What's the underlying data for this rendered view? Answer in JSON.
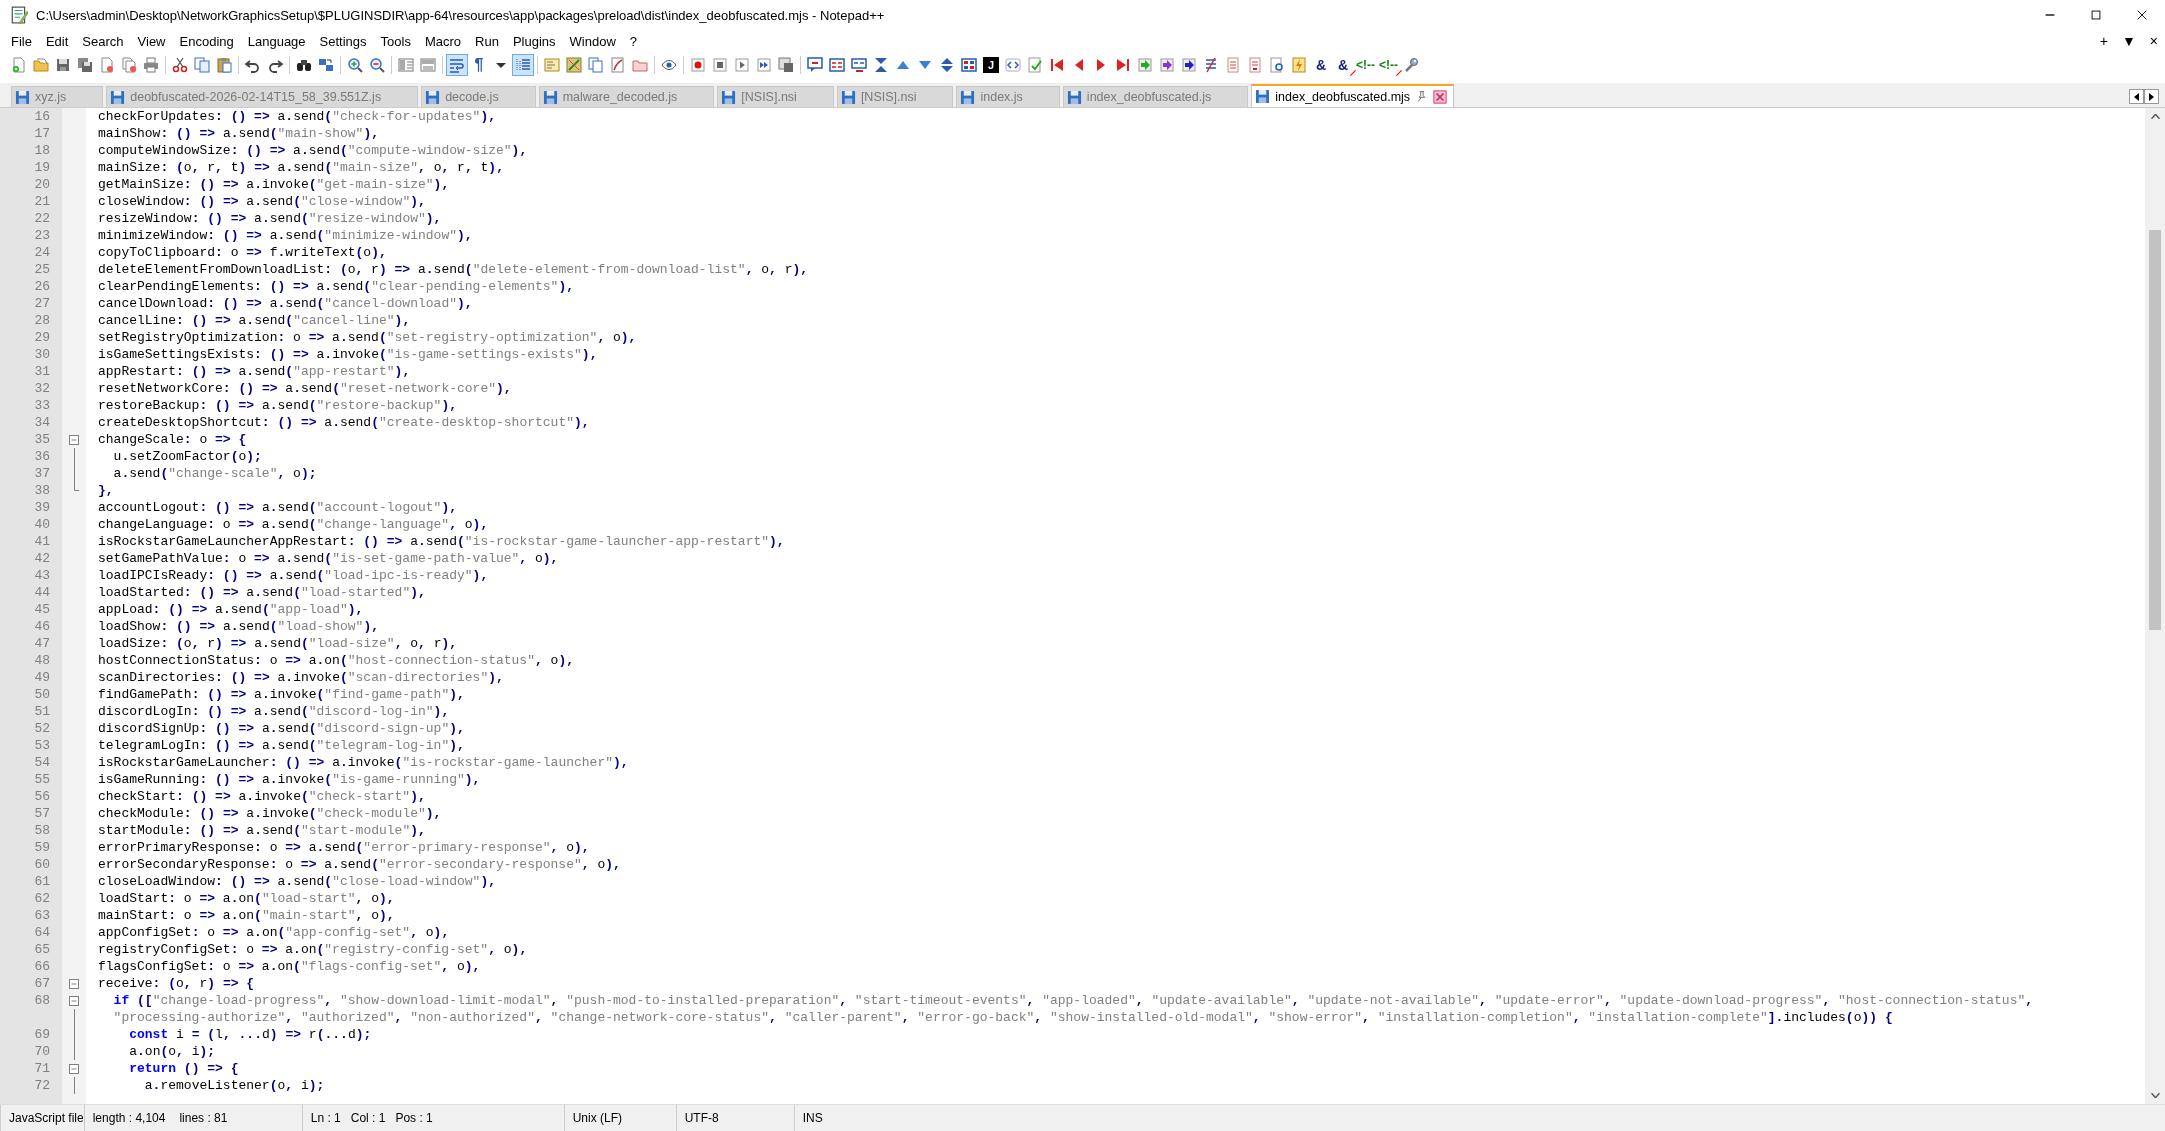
{
  "window": {
    "title": "C:\\Users\\admin\\Desktop\\NetworkGraphicsSetup\\$PLUGINSDIR\\app-64\\resources\\app\\packages\\preload\\dist\\index_deobfuscated.mjs - Notepad++"
  },
  "menu_bar": {
    "items": [
      "File",
      "Edit",
      "Search",
      "View",
      "Encoding",
      "Language",
      "Settings",
      "Tools",
      "Macro",
      "Run",
      "Plugins",
      "Window",
      "?"
    ],
    "right_controls": [
      "+",
      "▼",
      "×"
    ]
  },
  "toolbar": {
    "toggle_buttons": [
      {
        "kind": "word-wrap",
        "pressed": true
      },
      {
        "kind": "indent-guide",
        "pressed": true
      }
    ],
    "glyph_buttons": [
      {
        "kind": "pilcrow",
        "text": "¶"
      },
      {
        "kind": "json",
        "text": "J"
      },
      {
        "kind": "ampersand",
        "text": "&"
      },
      {
        "kind": "ampersand-struck",
        "text": "&"
      },
      {
        "kind": "comment",
        "text": "<!--"
      },
      {
        "kind": "comment-struck",
        "text": "<!--"
      }
    ]
  },
  "tabs": [
    {
      "label": "xyz.js",
      "selected": false
    },
    {
      "label": "deobfuscated-2026-02-14T15_58_39.551Z.js",
      "selected": false
    },
    {
      "label": "decode.js",
      "selected": false
    },
    {
      "label": "malware_decoded.js",
      "selected": false
    },
    {
      "label": "[NSIS].nsi",
      "selected": false
    },
    {
      "label": "[NSIS].nsi",
      "selected": false
    },
    {
      "label": "index.js",
      "selected": false
    },
    {
      "label": "index_deobfuscated.js",
      "selected": false
    },
    {
      "label": "index_deobfuscated.mjs",
      "selected": true
    }
  ],
  "editor": {
    "lines": [
      {
        "number": "16",
        "text": "checkForUpdates: () => a.send(\"check-for-updates\"),",
        "kind": "plain",
        "fold_toggle": false,
        "in_fold": false,
        "fold_end": false
      },
      {
        "number": "17",
        "text": "mainShow: () => a.send(\"main-show\"),",
        "kind": "plain",
        "fold_toggle": false,
        "in_fold": false,
        "fold_end": false
      },
      {
        "number": "18",
        "text": "computeWindowSize: () => a.send(\"compute-window-size\"),",
        "kind": "plain",
        "fold_toggle": false,
        "in_fold": false,
        "fold_end": false
      },
      {
        "number": "19",
        "text": "mainSize: (o, r, t) => a.send(\"main-size\", o, r, t),",
        "kind": "plain",
        "fold_toggle": false,
        "in_fold": false,
        "fold_end": false
      },
      {
        "number": "20",
        "text": "getMainSize: () => a.invoke(\"get-main-size\"),",
        "kind": "plain",
        "fold_toggle": false,
        "in_fold": false,
        "fold_end": false
      },
      {
        "number": "21",
        "text": "closeWindow: () => a.send(\"close-window\"),",
        "kind": "plain",
        "fold_toggle": false,
        "in_fold": false,
        "fold_end": false
      },
      {
        "number": "22",
        "text": "resizeWindow: () => a.send(\"resize-window\"),",
        "kind": "plain",
        "fold_toggle": false,
        "in_fold": false,
        "fold_end": false
      },
      {
        "number": "23",
        "text": "minimizeWindow: () => a.send(\"minimize-window\"),",
        "kind": "plain",
        "fold_toggle": false,
        "in_fold": false,
        "fold_end": false
      },
      {
        "number": "24",
        "text": "copyToClipboard: o => f.writeText(o),",
        "kind": "plain",
        "fold_toggle": false,
        "in_fold": false,
        "fold_end": false
      },
      {
        "number": "25",
        "text": "deleteElementFromDownloadList: (o, r) => a.send(\"delete-element-from-download-list\", o, r),",
        "kind": "plain",
        "fold_toggle": false,
        "in_fold": false,
        "fold_end": false
      },
      {
        "number": "26",
        "text": "clearPendingElements: () => a.send(\"clear-pending-elements\"),",
        "kind": "plain",
        "fold_toggle": false,
        "in_fold": false,
        "fold_end": false
      },
      {
        "number": "27",
        "text": "cancelDownload: () => a.send(\"cancel-download\"),",
        "kind": "plain",
        "fold_toggle": false,
        "in_fold": false,
        "fold_end": false
      },
      {
        "number": "28",
        "text": "cancelLine: () => a.send(\"cancel-line\"),",
        "kind": "plain",
        "fold_toggle": false,
        "in_fold": false,
        "fold_end": false
      },
      {
        "number": "29",
        "text": "setRegistryOptimization: o => a.send(\"set-registry-optimization\", o),",
        "kind": "plain",
        "fold_toggle": false,
        "in_fold": false,
        "fold_end": false
      },
      {
        "number": "30",
        "text": "isGameSettingsExists: () => a.invoke(\"is-game-settings-exists\"),",
        "kind": "plain",
        "fold_toggle": false,
        "in_fold": false,
        "fold_end": false
      },
      {
        "number": "31",
        "text": "appRestart: () => a.send(\"app-restart\"),",
        "kind": "plain",
        "fold_toggle": false,
        "in_fold": false,
        "fold_end": false
      },
      {
        "number": "32",
        "text": "resetNetworkCore: () => a.send(\"reset-network-core\"),",
        "kind": "plain",
        "fold_toggle": false,
        "in_fold": false,
        "fold_end": false
      },
      {
        "number": "33",
        "text": "restoreBackup: () => a.send(\"restore-backup\"),",
        "kind": "plain",
        "fold_toggle": false,
        "in_fold": false,
        "fold_end": false
      },
      {
        "number": "34",
        "text": "createDesktopShortcut: () => a.send(\"create-desktop-shortcut\"),",
        "kind": "plain",
        "fold_toggle": false,
        "in_fold": false,
        "fold_end": false
      },
      {
        "number": "35",
        "text": "changeScale: o => {",
        "kind": "plain",
        "fold_toggle": true,
        "in_fold": false,
        "fold_end": false
      },
      {
        "number": "36",
        "text": "  u.setZoomFactor(o);",
        "kind": "plain",
        "fold_toggle": false,
        "in_fold": true,
        "fold_end": false
      },
      {
        "number": "37",
        "text": "  a.send(\"change-scale\", o);",
        "kind": "plain",
        "fold_toggle": false,
        "in_fold": true,
        "fold_end": false
      },
      {
        "number": "38",
        "text": "},",
        "kind": "plain",
        "fold_toggle": false,
        "in_fold": true,
        "fold_end": true
      },
      {
        "number": "39",
        "text": "accountLogout: () => a.send(\"account-logout\"),",
        "kind": "plain",
        "fold_toggle": false,
        "in_fold": false,
        "fold_end": false
      },
      {
        "number": "40",
        "text": "changeLanguage: o => a.send(\"change-language\", o),",
        "kind": "plain",
        "fold_toggle": false,
        "in_fold": false,
        "fold_end": false
      },
      {
        "number": "41",
        "text": "isRockstarGameLauncherAppRestart: () => a.send(\"is-rockstar-game-launcher-app-restart\"),",
        "kind": "plain",
        "fold_toggle": false,
        "in_fold": false,
        "fold_end": false
      },
      {
        "number": "42",
        "text": "setGamePathValue: o => a.send(\"is-set-game-path-value\", o),",
        "kind": "plain",
        "fold_toggle": false,
        "in_fold": false,
        "fold_end": false
      },
      {
        "number": "43",
        "text": "loadIPCIsReady: () => a.send(\"load-ipc-is-ready\"),",
        "kind": "plain",
        "fold_toggle": false,
        "in_fold": false,
        "fold_end": false
      },
      {
        "number": "44",
        "text": "loadStarted: () => a.send(\"load-started\"),",
        "kind": "plain",
        "fold_toggle": false,
        "in_fold": false,
        "fold_end": false
      },
      {
        "number": "45",
        "text": "appLoad: () => a.send(\"app-load\"),",
        "kind": "plain",
        "fold_toggle": false,
        "in_fold": false,
        "fold_end": false
      },
      {
        "number": "46",
        "text": "loadShow: () => a.send(\"load-show\"),",
        "kind": "plain",
        "fold_toggle": false,
        "in_fold": false,
        "fold_end": false
      },
      {
        "number": "47",
        "text": "loadSize: (o, r) => a.send(\"load-size\", o, r),",
        "kind": "plain",
        "fold_toggle": false,
        "in_fold": false,
        "fold_end": false
      },
      {
        "number": "48",
        "text": "hostConnectionStatus: o => a.on(\"host-connection-status\", o),",
        "kind": "plain",
        "fold_toggle": false,
        "in_fold": false,
        "fold_end": false
      },
      {
        "number": "49",
        "text": "scanDirectories: () => a.invoke(\"scan-directories\"),",
        "kind": "plain",
        "fold_toggle": false,
        "in_fold": false,
        "fold_end": false
      },
      {
        "number": "50",
        "text": "findGamePath: () => a.invoke(\"find-game-path\"),",
        "kind": "plain",
        "fold_toggle": false,
        "in_fold": false,
        "fold_end": false
      },
      {
        "number": "51",
        "text": "discordLogIn: () => a.send(\"discord-log-in\"),",
        "kind": "plain",
        "fold_toggle": false,
        "in_fold": false,
        "fold_end": false
      },
      {
        "number": "52",
        "text": "discordSignUp: () => a.send(\"discord-sign-up\"),",
        "kind": "plain",
        "fold_toggle": false,
        "in_fold": false,
        "fold_end": false
      },
      {
        "number": "53",
        "text": "telegramLogIn: () => a.send(\"telegram-log-in\"),",
        "kind": "plain",
        "fold_toggle": false,
        "in_fold": false,
        "fold_end": false
      },
      {
        "number": "54",
        "text": "isRockstarGameLauncher: () => a.invoke(\"is-rockstar-game-launcher\"),",
        "kind": "plain",
        "fold_toggle": false,
        "in_fold": false,
        "fold_end": false
      },
      {
        "number": "55",
        "text": "isGameRunning: () => a.invoke(\"is-game-running\"),",
        "kind": "plain",
        "fold_toggle": false,
        "in_fold": false,
        "fold_end": false
      },
      {
        "number": "56",
        "text": "checkStart: () => a.invoke(\"check-start\"),",
        "kind": "plain",
        "fold_toggle": false,
        "in_fold": false,
        "fold_end": false
      },
      {
        "number": "57",
        "text": "checkModule: () => a.invoke(\"check-module\"),",
        "kind": "plain",
        "fold_toggle": false,
        "in_fold": false,
        "fold_end": false
      },
      {
        "number": "58",
        "text": "startModule: () => a.send(\"start-module\"),",
        "kind": "plain",
        "fold_toggle": false,
        "in_fold": false,
        "fold_end": false
      },
      {
        "number": "59",
        "text": "errorPrimaryResponse: o => a.send(\"error-primary-response\", o),",
        "kind": "plain",
        "fold_toggle": false,
        "in_fold": false,
        "fold_end": false
      },
      {
        "number": "60",
        "text": "errorSecondaryResponse: o => a.send(\"error-secondary-response\", o),",
        "kind": "plain",
        "fold_toggle": false,
        "in_fold": false,
        "fold_end": false
      },
      {
        "number": "61",
        "text": "closeLoadWindow: () => a.send(\"close-load-window\"),",
        "kind": "plain",
        "fold_toggle": false,
        "in_fold": false,
        "fold_end": false
      },
      {
        "number": "62",
        "text": "loadStart: o => a.on(\"load-start\", o),",
        "kind": "plain",
        "fold_toggle": false,
        "in_fold": false,
        "fold_end": false
      },
      {
        "number": "63",
        "text": "mainStart: o => a.on(\"main-start\", o),",
        "kind": "plain",
        "fold_toggle": false,
        "in_fold": false,
        "fold_end": false
      },
      {
        "number": "64",
        "text": "appConfigSet: o => a.on(\"app-config-set\", o),",
        "kind": "plain",
        "fold_toggle": false,
        "in_fold": false,
        "fold_end": false
      },
      {
        "number": "65",
        "text": "registryConfigSet: o => a.on(\"registry-config-set\", o),",
        "kind": "plain",
        "fold_toggle": false,
        "in_fold": false,
        "fold_end": false
      },
      {
        "number": "66",
        "text": "flagsConfigSet: o => a.on(\"flags-config-set\", o),",
        "kind": "plain",
        "fold_toggle": false,
        "in_fold": false,
        "fold_end": false
      },
      {
        "number": "67",
        "text": "receive: (o, r) => {",
        "kind": "plain",
        "fold_toggle": true,
        "in_fold": false,
        "fold_end": false
      },
      {
        "number": "68",
        "text": "  if ([\"change-load-progress\", \"show-download-limit-modal\", \"push-mod-to-installed-preparation\", \"start-timeout-events\", \"app-loaded\", \"update-available\", \"update-not-available\", \"update-error\", \"update-download-progress\", \"host-connection-status\",",
        "wrapped": "  \"processing-authorize\", \"authorized\", \"non-authorized\", \"change-network-core-status\", \"caller-parent\", \"error-go-back\", \"show-installed-old-modal\", \"show-error\", \"installation-completion\", \"installation-complete\"].includes(o)) {",
        "kind": "keyword",
        "fold_toggle": true,
        "in_fold": true,
        "fold_end": false
      },
      {
        "number": "69",
        "text": "    const i = (l, ...d) => r(...d);",
        "kind": "keyword",
        "fold_toggle": false,
        "in_fold": true,
        "fold_end": false
      },
      {
        "number": "70",
        "text": "    a.on(o, i);",
        "kind": "plain",
        "fold_toggle": false,
        "in_fold": true,
        "fold_end": false
      },
      {
        "number": "71",
        "text": "    return () => {",
        "kind": "keyword",
        "fold_toggle": true,
        "in_fold": true,
        "fold_end": false
      },
      {
        "number": "72",
        "text": "      a.removeListener(o, i);",
        "kind": "plain",
        "fold_toggle": false,
        "in_fold": true,
        "fold_end": false
      }
    ]
  },
  "status_bar": {
    "file_type": "JavaScript file",
    "length": "length : 4,104",
    "lines": "lines : 81",
    "line": "Ln : 1",
    "column": "Col : 1",
    "position": "Pos : 1",
    "eol": "Unix (LF)",
    "encoding": "UTF-8",
    "mode": "INS"
  }
}
